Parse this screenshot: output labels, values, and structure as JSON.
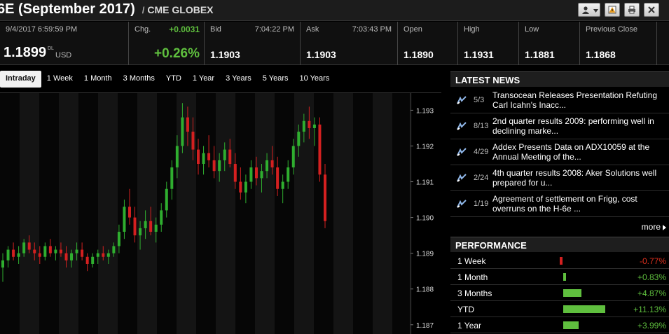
{
  "header": {
    "title": "6E (September 2017)",
    "separator": "/",
    "exchange": "CME GLOBEX"
  },
  "quote": {
    "timestamp": "9/4/2017 6:59:59 PM",
    "last": "1.1899",
    "last_sup": "DL",
    "currency": "USD",
    "chg_label": "Chg.",
    "chg": "+0.0031",
    "chg_pct": "+0.26%",
    "bid_label": "Bid",
    "bid_time": "7:04:22 PM",
    "bid": "1.1903",
    "ask_label": "Ask",
    "ask_time": "7:03:43 PM",
    "ask": "1.1903",
    "open_label": "Open",
    "open": "1.1890",
    "high_label": "High",
    "high": "1.1931",
    "low_label": "Low",
    "low": "1.1881",
    "prev_label": "Previous Close",
    "prev": "1.1868"
  },
  "ranges": [
    "Intraday",
    "1 Week",
    "1 Month",
    "3 Months",
    "YTD",
    "1 Year",
    "3 Years",
    "5 Years",
    "10 Years"
  ],
  "active_range": "Intraday",
  "colors": {
    "up": "#2fae2f",
    "down": "#d42020",
    "pos_text": "#5fbf3e",
    "neg_text": "#e0301e"
  },
  "chart_data": {
    "type": "candlestick",
    "ylim": [
      1.1868,
      1.1934
    ],
    "yticks": [
      "1.193",
      "1.192",
      "1.191",
      "1.190",
      "1.189",
      "1.188",
      "1.187"
    ],
    "ytick_values": [
      1.193,
      1.192,
      1.191,
      1.19,
      1.189,
      1.188,
      1.187
    ],
    "series": [
      {
        "ohlc": [
          [
            1.1886,
            1.189,
            1.1882,
            1.1888
          ],
          [
            1.1888,
            1.1892,
            1.1886,
            1.1891
          ],
          [
            1.1891,
            1.1893,
            1.1888,
            1.1889
          ],
          [
            1.1889,
            1.1892,
            1.1887,
            1.189
          ],
          [
            1.189,
            1.1894,
            1.1889,
            1.1893
          ],
          [
            1.1893,
            1.1895,
            1.189,
            1.1891
          ],
          [
            1.1891,
            1.1893,
            1.1888,
            1.189
          ],
          [
            1.189,
            1.1892,
            1.1887,
            1.1889
          ],
          [
            1.1889,
            1.1893,
            1.1888,
            1.1892
          ],
          [
            1.1892,
            1.1894,
            1.1889,
            1.189
          ],
          [
            1.189,
            1.1892,
            1.1888,
            1.1891
          ],
          [
            1.1891,
            1.1893,
            1.1889,
            1.189
          ],
          [
            1.189,
            1.1892,
            1.1886,
            1.1888
          ],
          [
            1.1888,
            1.1891,
            1.1886,
            1.189
          ],
          [
            1.189,
            1.1893,
            1.1888,
            1.1891
          ],
          [
            1.1891,
            1.1893,
            1.1888,
            1.1889
          ],
          [
            1.1889,
            1.189,
            1.1885,
            1.1887
          ],
          [
            1.1887,
            1.189,
            1.1886,
            1.1889
          ],
          [
            1.1889,
            1.1891,
            1.1887,
            1.189
          ],
          [
            1.189,
            1.1892,
            1.1888,
            1.1889
          ],
          [
            1.1889,
            1.1891,
            1.1887,
            1.189
          ],
          [
            1.189,
            1.1893,
            1.1889,
            1.1892
          ],
          [
            1.1892,
            1.1898,
            1.189,
            1.1896
          ],
          [
            1.1896,
            1.1905,
            1.1894,
            1.1903
          ],
          [
            1.1903,
            1.1908,
            1.1898,
            1.19
          ],
          [
            1.19,
            1.1903,
            1.1893,
            1.1895
          ],
          [
            1.1895,
            1.1899,
            1.1891,
            1.1897
          ],
          [
            1.1897,
            1.1902,
            1.1894,
            1.1899
          ],
          [
            1.1899,
            1.1903,
            1.1895,
            1.1896
          ],
          [
            1.1896,
            1.19,
            1.1893,
            1.1898
          ],
          [
            1.1898,
            1.1904,
            1.1896,
            1.1902
          ],
          [
            1.1902,
            1.191,
            1.19,
            1.1908
          ],
          [
            1.1908,
            1.1916,
            1.1905,
            1.1914
          ],
          [
            1.1914,
            1.1923,
            1.1911,
            1.192
          ],
          [
            1.192,
            1.1932,
            1.1918,
            1.1928
          ],
          [
            1.1928,
            1.1931,
            1.192,
            1.1924
          ],
          [
            1.1924,
            1.1928,
            1.1916,
            1.1919
          ],
          [
            1.1919,
            1.1922,
            1.1912,
            1.1915
          ],
          [
            1.1915,
            1.192,
            1.1912,
            1.1918
          ],
          [
            1.1918,
            1.1923,
            1.1914,
            1.1916
          ],
          [
            1.1916,
            1.192,
            1.1911,
            1.1913
          ],
          [
            1.1913,
            1.1918,
            1.191,
            1.1916
          ],
          [
            1.1916,
            1.1921,
            1.1913,
            1.1919
          ],
          [
            1.1919,
            1.1922,
            1.1914,
            1.1915
          ],
          [
            1.1915,
            1.1918,
            1.1908,
            1.191
          ],
          [
            1.191,
            1.1914,
            1.1905,
            1.1907
          ],
          [
            1.1907,
            1.1912,
            1.1904,
            1.191
          ],
          [
            1.191,
            1.1916,
            1.1908,
            1.1914
          ],
          [
            1.1914,
            1.1917,
            1.1909,
            1.1911
          ],
          [
            1.1911,
            1.1915,
            1.1907,
            1.1913
          ],
          [
            1.1913,
            1.1918,
            1.1911,
            1.1916
          ],
          [
            1.1916,
            1.192,
            1.1912,
            1.1914
          ],
          [
            1.1914,
            1.1917,
            1.1906,
            1.1908
          ],
          [
            1.1908,
            1.1912,
            1.1904,
            1.191
          ],
          [
            1.191,
            1.1916,
            1.1908,
            1.1914
          ],
          [
            1.1914,
            1.1922,
            1.1912,
            1.192
          ],
          [
            1.192,
            1.1926,
            1.1917,
            1.1924
          ],
          [
            1.1924,
            1.1929,
            1.1921,
            1.1927
          ],
          [
            1.1927,
            1.1931,
            1.1922,
            1.1925
          ],
          [
            1.1925,
            1.1928,
            1.192,
            1.1926
          ],
          [
            1.1926,
            1.1928,
            1.191,
            1.1912
          ],
          [
            1.1912,
            1.1915,
            1.1897,
            1.1899
          ]
        ]
      }
    ]
  },
  "news": {
    "title": "LATEST NEWS",
    "items": [
      {
        "date": "5/3",
        "text": "Transocean Releases Presentation Refuting Carl Icahn's Inacc..."
      },
      {
        "date": "8/13",
        "text": "2nd quarter results 2009: performing well in declining marke..."
      },
      {
        "date": "4/29",
        "text": "Addex Presents Data on ADX10059 at the Annual Meeting of the..."
      },
      {
        "date": "2/24",
        "text": "4th quarter results 2008: Aker Solutions well prepared for u..."
      },
      {
        "date": "1/19",
        "text": "Agreement of settlement on Frigg, cost overruns on the H-6e ..."
      }
    ],
    "more_label": "more"
  },
  "performance": {
    "title": "PERFORMANCE",
    "rows": [
      {
        "label": "1 Week",
        "pct": "-0.77%",
        "value": -0.77
      },
      {
        "label": "1 Month",
        "pct": "+0.83%",
        "value": 0.83
      },
      {
        "label": "3 Months",
        "pct": "+4.87%",
        "value": 4.87
      },
      {
        "label": "YTD",
        "pct": "+11.13%",
        "value": 11.13
      },
      {
        "label": "1 Year",
        "pct": "+3.99%",
        "value": 3.99
      }
    ]
  }
}
